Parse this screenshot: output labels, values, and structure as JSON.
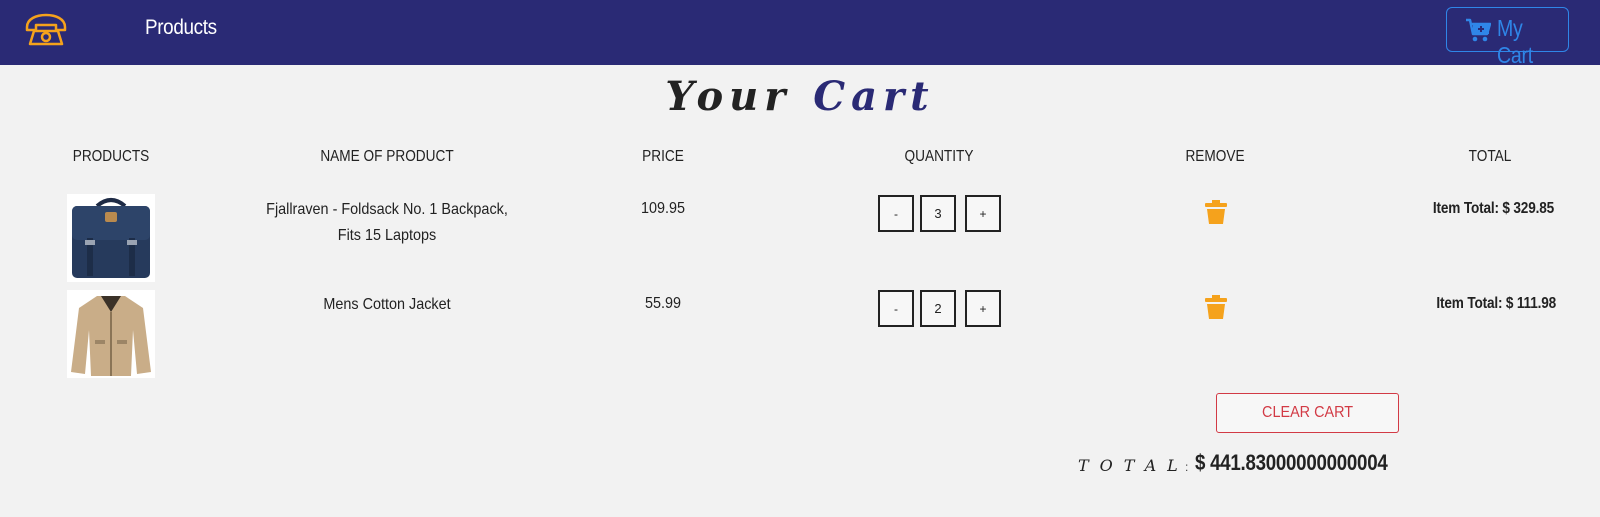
{
  "nav": {
    "logo_icon": "phone-icon",
    "products_link": "Products",
    "cart_button_label": "My Cart",
    "cart_icon": "cart-icon",
    "bg_color": "#2a2a75",
    "accent_color": "#2f86e8",
    "logo_color": "#f5a21c"
  },
  "page": {
    "title_word1": "Your",
    "title_word2": "Cart"
  },
  "table": {
    "headers": [
      "PRODUCTS",
      "NAME OF PRODUCT",
      "PRICE",
      "QUANTITY",
      "REMOVE",
      "TOTAL"
    ],
    "rows": [
      {
        "image": "backpack-image",
        "name": "Fjallraven - Foldsack No. 1 Backpack, Fits 15 Laptops",
        "price": "109.95",
        "decrement": "-",
        "quantity": "3",
        "increment": "+",
        "remove_icon": "trash-icon",
        "item_total": "Item Total: $ 329.85"
      },
      {
        "image": "jacket-image",
        "name": "Mens Cotton Jacket",
        "price": "55.99",
        "decrement": "-",
        "quantity": "2",
        "increment": "+",
        "remove_icon": "trash-icon",
        "item_total": "Item Total: $ 111.98"
      }
    ]
  },
  "footer": {
    "clear_cart_label": "CLEAR CART",
    "total_label": "TOTAL",
    "total_colon": ":",
    "total_value": "$ 441.83000000000004",
    "danger_color": "#d23a45",
    "trash_color": "#f5a21c"
  }
}
